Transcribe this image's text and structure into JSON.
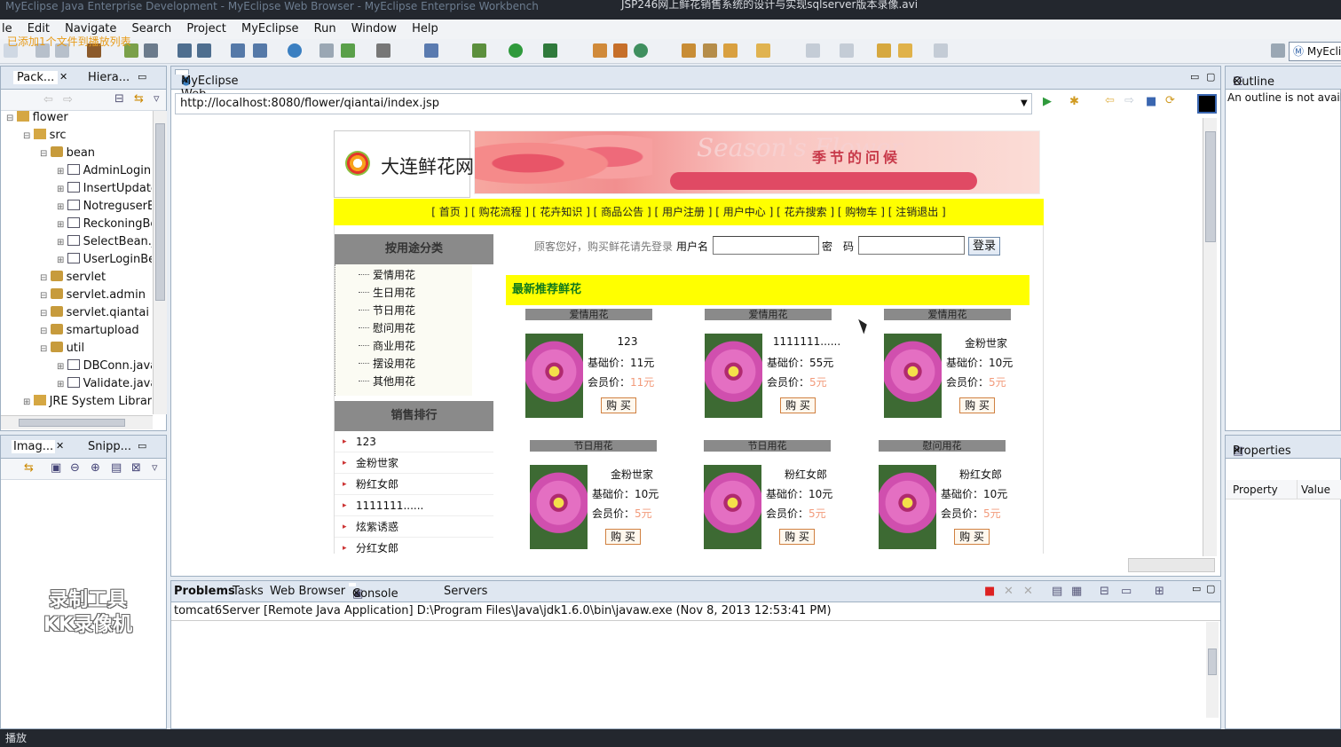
{
  "window": {
    "title_left": "MyEclipse Java Enterprise Development - MyEclipse Web Browser - MyEclipse Enterprise Workbench",
    "title_center": "JSP246网上鲜花销售系统的设计与实现sqlserver版本录像.avi"
  },
  "menu": [
    "le",
    "Edit",
    "Navigate",
    "Search",
    "Project",
    "MyEclipse",
    "Run",
    "Window",
    "Help"
  ],
  "notice": "已添加1个文件到播放列表",
  "package_explorer": {
    "tabs": [
      "Pack...",
      "Hiera..."
    ],
    "tree": [
      {
        "label": "flower",
        "type": "project",
        "depth": 0
      },
      {
        "label": "src",
        "type": "folder",
        "depth": 1
      },
      {
        "label": "bean",
        "type": "package",
        "depth": 2
      },
      {
        "label": "AdminLoginB",
        "type": "java",
        "depth": 3
      },
      {
        "label": "InsertUpdate",
        "type": "java",
        "depth": 3
      },
      {
        "label": "NotreguserB",
        "type": "java",
        "depth": 3
      },
      {
        "label": "ReckoningBe",
        "type": "java",
        "depth": 3
      },
      {
        "label": "SelectBean.ja",
        "type": "java",
        "depth": 3
      },
      {
        "label": "UserLoginBe",
        "type": "java",
        "depth": 3
      },
      {
        "label": "servlet",
        "type": "package",
        "depth": 2
      },
      {
        "label": "servlet.admin",
        "type": "package",
        "depth": 2
      },
      {
        "label": "servlet.qiantai",
        "type": "package",
        "depth": 2
      },
      {
        "label": "smartupload",
        "type": "package",
        "depth": 2
      },
      {
        "label": "util",
        "type": "package",
        "depth": 2
      },
      {
        "label": "DBConn.java",
        "type": "java",
        "depth": 3
      },
      {
        "label": "Validate.java",
        "type": "java",
        "depth": 3
      },
      {
        "label": "JRE System Library",
        "type": "library",
        "depth": 1
      }
    ]
  },
  "image_panel": {
    "tabs": [
      "Imag...",
      "Snipp..."
    ]
  },
  "watermark": {
    "line1": "录制工具",
    "line2": "KK录像机"
  },
  "browser": {
    "tab": "MyEclipse Web Browser",
    "url": "http://localhost:8080/flower/qiantai/index.jsp"
  },
  "site": {
    "logo": "大连鲜花网",
    "banner_text": "季节的问候",
    "banner_script": "Season's Flower",
    "nav": "[ 首页 ] [ 购花流程 ] [ 花卉知识 ] [ 商品公告 ] [ 用户注册 ] [ 用户中心 ] [ 花卉搜索 ] [ 购物车 ] [ 注销退出 ]",
    "category_title": "按用途分类",
    "categories": [
      "爱情用花",
      "生日用花",
      "节日用花",
      "慰问用花",
      "商业用花",
      "摆设用花",
      "其他用花"
    ],
    "rank_title": "销售排行",
    "ranking": [
      "123",
      "金粉世家",
      "粉红女郎",
      "1111111......",
      "炫紫诱惑",
      "分红女郎"
    ],
    "login_prompt": "顾客您好，购买鲜花请先登录",
    "username_label": "用户名",
    "password_label": "密　码",
    "login_button": "登录",
    "recommend_title": "最新推荐鲜花",
    "base_label": "基础价：",
    "member_label": "会员价：",
    "buy_label": "购 买",
    "products": [
      {
        "category": "爱情用花",
        "name": "123",
        "base": "11元",
        "member": "11元"
      },
      {
        "category": "爱情用花",
        "name": "1111111......",
        "base": "55元",
        "member": "5元"
      },
      {
        "category": "爱情用花",
        "name": "金粉世家",
        "base": "10元",
        "member": "5元"
      },
      {
        "category": "节日用花",
        "name": "金粉世家",
        "base": "10元",
        "member": "5元"
      },
      {
        "category": "节日用花",
        "name": "粉红女郎",
        "base": "10元",
        "member": "5元"
      },
      {
        "category": "慰问用花",
        "name": "粉红女郎",
        "base": "10元",
        "member": "5元"
      }
    ]
  },
  "outline": {
    "tab": "Outline",
    "message": "An outline is not availa"
  },
  "properties": {
    "tab": "Properties",
    "col_property": "Property",
    "col_value": "Value"
  },
  "console": {
    "tabs": [
      "Problems",
      "Tasks",
      "Web Browser",
      "Console",
      "Servers"
    ],
    "line": "tomcat6Server [Remote Java Application] D:\\Program Files\\Java\\jdk1.6.0\\bin\\javaw.exe (Nov 8, 2013 12:53:41 PM)"
  },
  "statusbar": "播放",
  "perspective": "MyEcli",
  "colors": {
    "nav_yellow": "#ffff00",
    "header_gray": "#8a8a8a",
    "recommend_green": "#117a1b",
    "member_price": "#f29a7a"
  }
}
